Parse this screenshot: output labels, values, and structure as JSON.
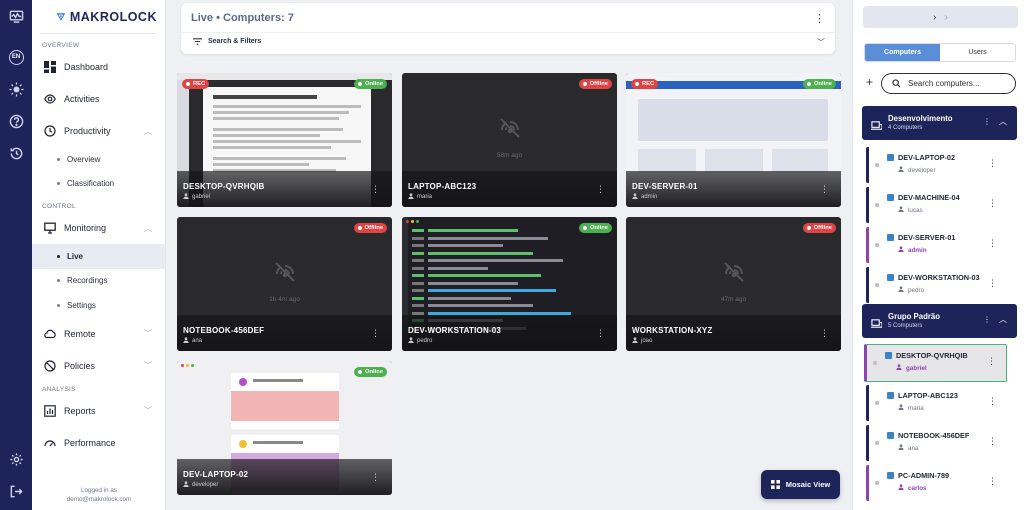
{
  "brand": {
    "name": "MAKROLOCK"
  },
  "rail": {
    "lang": "EN"
  },
  "sidebar": {
    "sections": {
      "overview": "OVERVIEW",
      "control": "CONTROL",
      "analysis": "ANALYSIS"
    },
    "items": {
      "dashboard": "Dashboard",
      "activities": "Activities",
      "productivity": "Productivity",
      "overview": "Overview",
      "classification": "Classification",
      "monitoring": "Monitoring",
      "live": "Live",
      "recordings": "Recordings",
      "settings": "Settings",
      "remote": "Remote",
      "policies": "Policies",
      "reports": "Reports",
      "performance": "Performance"
    },
    "logged_in_label": "Logged in as",
    "logged_in_user": "demo@makrolock.com"
  },
  "header": {
    "live": "Live",
    "sep": "•",
    "computers": "Computers: 7",
    "search_filters": "Search & Filters"
  },
  "tiles": [
    {
      "name": "DESKTOP-QVRHQIB",
      "user": "gabriel",
      "status": "Online",
      "rec": "REC"
    },
    {
      "name": "LAPTOP-ABC123",
      "user": "maria",
      "status": "Offline",
      "ago": "58m ago"
    },
    {
      "name": "DEV-SERVER-01",
      "user": "admin",
      "status": "Online",
      "rec": "REC"
    },
    {
      "name": "NOTEBOOK-456DEF",
      "user": "ana",
      "status": "Offline",
      "ago": "1h 4m ago"
    },
    {
      "name": "DEV-WORKSTATION-03",
      "user": "pedro",
      "status": "Online"
    },
    {
      "name": "WORKSTATION-XYZ",
      "user": "joao",
      "status": "Offline",
      "ago": "47m ago"
    },
    {
      "name": "DEV-LAPTOP-02",
      "user": "developer",
      "status": "Online"
    }
  ],
  "mosaic_label": "Mosaic View",
  "panel": {
    "crumb_left": "›",
    "crumb_right": "›",
    "tabs": {
      "computers": "Computers",
      "users": "Users"
    },
    "add": "+",
    "search_placeholder": "Search computers...",
    "groups": [
      {
        "name": "Desenvolvimento",
        "count": "4 Computers",
        "pcs": [
          {
            "name": "DEV-LAPTOP-02",
            "user": "developer"
          },
          {
            "name": "DEV-MACHINE-04",
            "user": "lucas"
          },
          {
            "name": "DEV-SERVER-01",
            "user": "admin"
          },
          {
            "name": "DEV-WORKSTATION-03",
            "user": "pedro"
          }
        ]
      },
      {
        "name": "Grupo Padrão",
        "count": "5 Computers",
        "pcs": [
          {
            "name": "DESKTOP-QVRHQIB",
            "user": "gabriel"
          },
          {
            "name": "LAPTOP-ABC123",
            "user": "maria"
          },
          {
            "name": "NOTEBOOK-456DEF",
            "user": "ana"
          },
          {
            "name": "PC-ADMIN-789",
            "user": "carlos"
          }
        ]
      }
    ]
  },
  "colors": {
    "navy": "#1d2459",
    "online": "#4caf50",
    "offline": "#e04343",
    "tab_active": "#5a8fd8",
    "admin_purple": "#8e44ad"
  }
}
